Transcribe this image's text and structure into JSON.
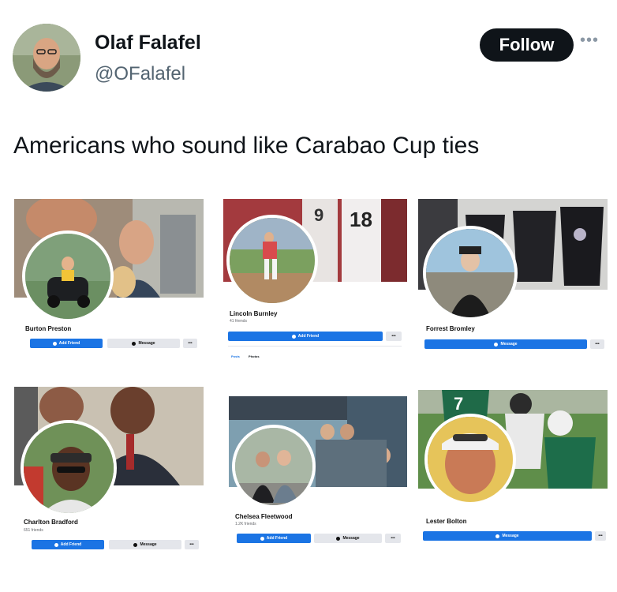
{
  "tweet": {
    "author_name": "Olaf Falafel",
    "author_handle": "@OFalafel",
    "follow_label": "Follow",
    "more_label": "•••",
    "text": "Americans who sound like Carabao Cup ties"
  },
  "cards": [
    {
      "name": "Burton Preston",
      "friends": "",
      "add_friend": "Add Friend",
      "message": "Message",
      "more": "•••"
    },
    {
      "name": "Lincoln Burnley",
      "friends": "41 friends",
      "add_friend": "Add Friend",
      "more": "•••",
      "tab_posts": "Posts",
      "tab_photos": "Photos"
    },
    {
      "name": "Forrest Bromley",
      "friends": "",
      "message": "Message",
      "more": "•••"
    },
    {
      "name": "Charlton Bradford",
      "friends": "651 friends",
      "add_friend": "Add Friend",
      "message": "Message",
      "more": "•••"
    },
    {
      "name": "Chelsea Fleetwood",
      "friends": "1.2K friends",
      "add_friend": "Add Friend",
      "message": "Message",
      "more": "•••"
    },
    {
      "name": "Lester Bolton",
      "friends": "",
      "message": "Message",
      "more": "•••"
    }
  ],
  "colors": {
    "follow_bg": "#0f1419",
    "facebook_blue": "#1b74e4",
    "grey_button": "#e4e6eb"
  }
}
